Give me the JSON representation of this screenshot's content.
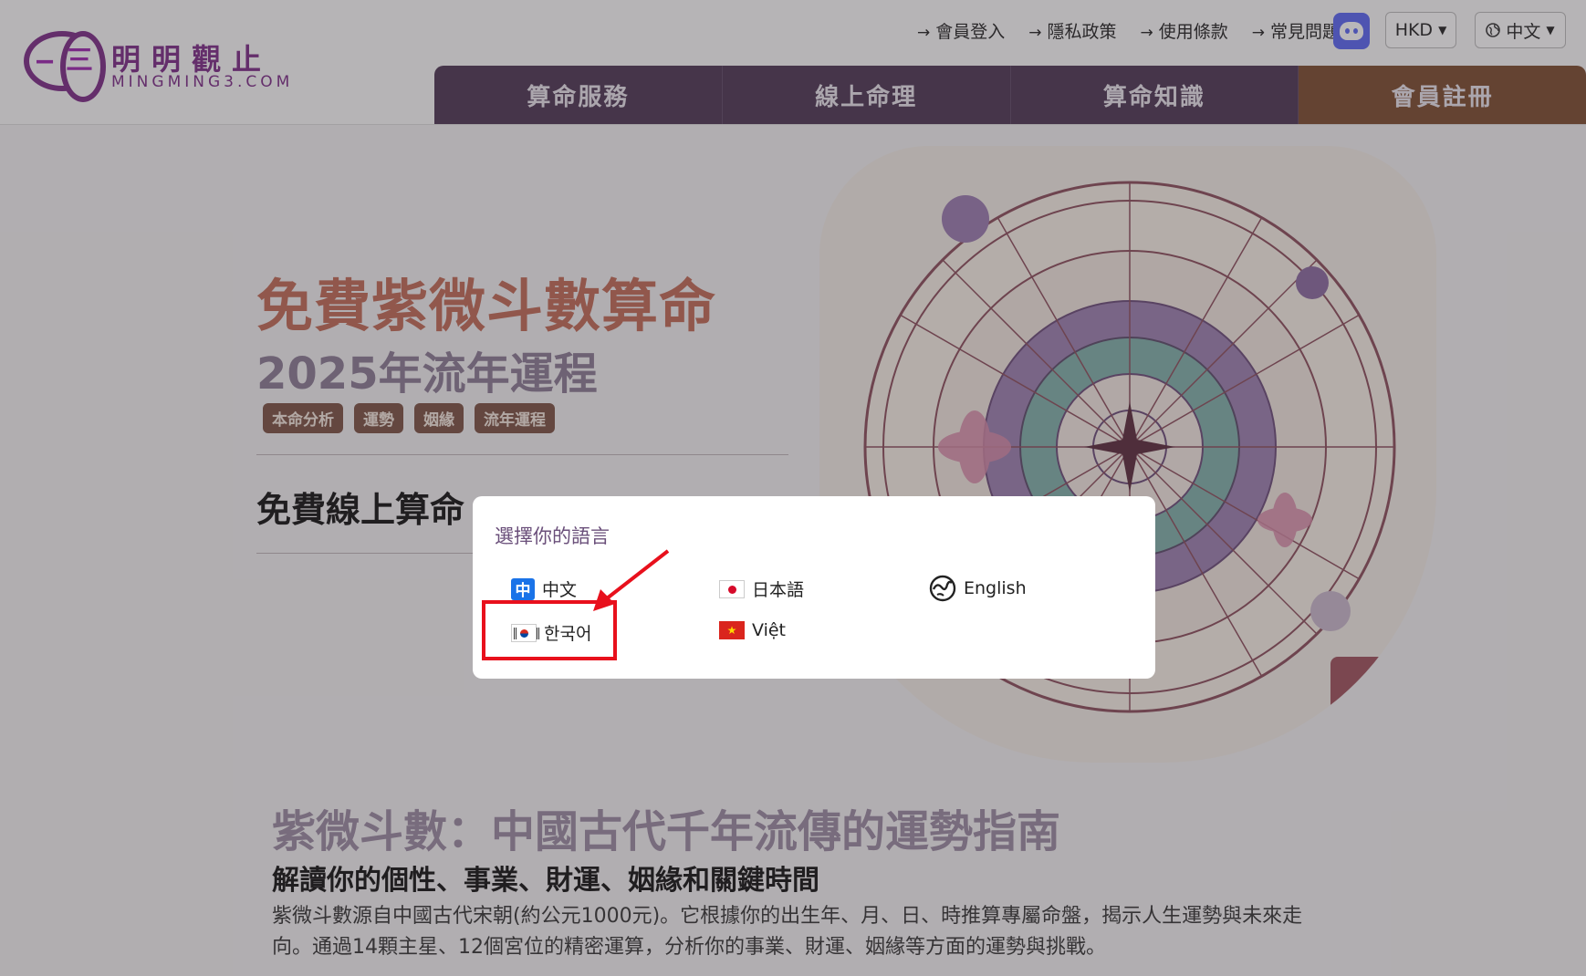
{
  "logo": {
    "name_cn": "明明觀止",
    "name_en": "MINGMING3.COM"
  },
  "toplinks": [
    {
      "label": "會員登入"
    },
    {
      "label": "隱私政策"
    },
    {
      "label": "使用條款"
    },
    {
      "label": "常見問題"
    }
  ],
  "currency": {
    "value": "HKD"
  },
  "language_select": {
    "value": "中文"
  },
  "nav": [
    {
      "label": "算命服務"
    },
    {
      "label": "線上命理"
    },
    {
      "label": "算命知識"
    },
    {
      "label": "會員註冊"
    }
  ],
  "hero": {
    "title": "免費紫微斗數算命",
    "subtitle": "2025年流年運程",
    "tags": [
      "本命分析",
      "運勢",
      "姻緣",
      "流年運程"
    ],
    "section_title": "免費線上算命"
  },
  "intro": {
    "title": "紫微斗數：中國古代千年流傳的運勢指南",
    "subtitle": "解讀你的個性、事業、財運、姻緣和關鍵時間",
    "body": "紫微斗數源自中國古代宋朝(約公元1000元)。它根據你的出生年、月、日、時推算專屬命盤，揭示人生運勢與未來走向。通過14顆主星、12個宮位的精密運算，分析你的事業、財運、姻緣等方面的運勢與挑戰。"
  },
  "modal": {
    "title": "選擇你的語言",
    "options": [
      {
        "label": "中文",
        "icon": "zh-flag-icon"
      },
      {
        "label": "日本語",
        "icon": "japan-flag-icon"
      },
      {
        "label": "English",
        "icon": "globe-icon"
      },
      {
        "label": "한국어",
        "icon": "korea-flag-icon"
      },
      {
        "label": "Việt",
        "icon": "vietnam-flag-icon"
      }
    ],
    "zh_flag_char": "中"
  },
  "colors": {
    "highlight": "#e8101c",
    "nav_bg": "#4b3552",
    "nav_register_bg": "#7a4a2c",
    "brand": "#7a2a86"
  }
}
